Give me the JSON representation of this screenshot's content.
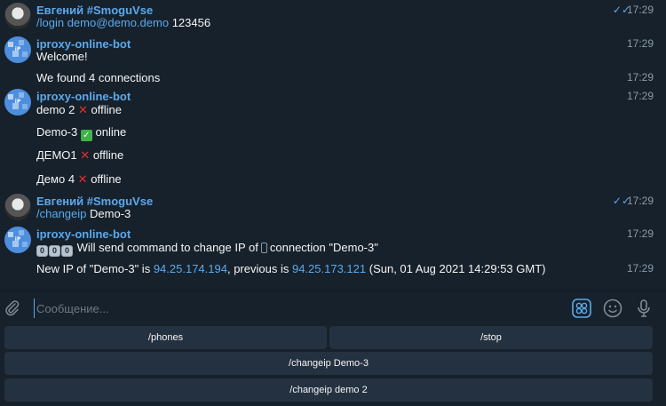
{
  "messages": [
    {
      "sender": "Евгений #SmoguVse",
      "avatar": "user-avatar",
      "read": true,
      "lines": [
        {
          "command": "/login demo@demo.demo",
          "text": "123456",
          "time": "17:29"
        }
      ]
    },
    {
      "sender": "iproxy-online-bot",
      "avatar": "bot-avatar",
      "lines": [
        {
          "text": "Welcome!",
          "time": "17:29"
        },
        {
          "text": "We found 4 connections",
          "time": "17:29"
        }
      ]
    },
    {
      "sender": "iproxy-online-bot",
      "avatar": "bot-avatar",
      "lines": [
        {
          "name": "demo 2",
          "status_icon": "cross-mark-icon",
          "status": "offline",
          "time": "17:29"
        },
        {
          "name": "Demo-3",
          "status_icon": "check-mark-icon",
          "status": "online"
        },
        {
          "name": "ДЕМО1",
          "status_icon": "cross-mark-icon",
          "status": "offline"
        },
        {
          "name": "Демо 4",
          "status_icon": "cross-mark-icon",
          "status": "offline"
        }
      ]
    },
    {
      "sender": "Евгений #SmoguVse",
      "avatar": "user-avatar",
      "read": true,
      "lines": [
        {
          "command": "/changeip",
          "text": "Demo-3",
          "time": "17:29"
        }
      ]
    },
    {
      "sender": "iproxy-online-bot",
      "avatar": "bot-avatar",
      "lines": [
        {
          "keycaps": [
            "0",
            "0",
            "0"
          ],
          "text_a": "Will send command to change IP of",
          "text_b": "connection \"Demo-3\"",
          "time": "17:29"
        },
        {
          "p1": "New IP of \"Demo-3\" is",
          "new_ip": "94.25.174.194",
          "p2": ", previous is",
          "old_ip": "94.25.173.121",
          "p3": "(Sun, 01 Aug 2021 14:29:53 GMT)",
          "time": "17:29"
        }
      ]
    }
  ],
  "composer": {
    "placeholder": "Сообщение..."
  },
  "keyboard": {
    "buttons": [
      "/phones",
      "/stop",
      "/changeip Demo-3",
      "/changeip demo 2"
    ]
  },
  "colors": {
    "background": "#17212b",
    "accent": "#5aa9ee",
    "button_bg": "#243140"
  }
}
